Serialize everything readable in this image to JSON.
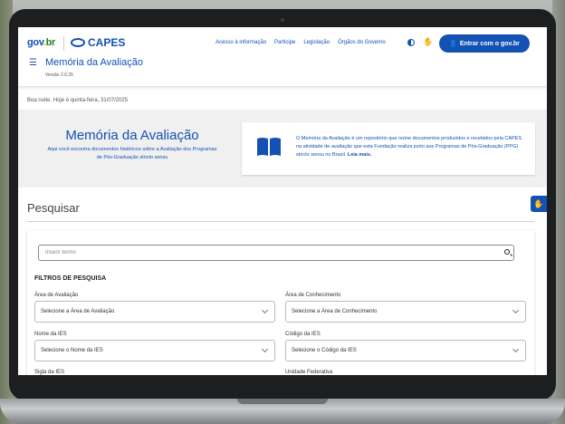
{
  "header": {
    "govbr_logo": {
      "part1": "gov",
      "part2": ".",
      "part3": "br"
    },
    "capes_logo": "CAPES",
    "nav": [
      "Acesso à informação",
      "Participe",
      "Legislação",
      "Órgãos do Governo"
    ],
    "login_button": "Entrar  com o gov.br",
    "site_title": "Memória da Avaliação",
    "version": "Versão 2.0.35"
  },
  "greeting": "Boa noite. Hoje é quinta-feira, 31/07/2025",
  "hero": {
    "title": "Memória da Avaliação",
    "subtitle": "Aqui você encontra documentos históricos sobre a Avaliação dos Programas de Pós-Graduação stricto sensu",
    "card_text": "O Memória da Avaliação é um repositório que reúne documentos produzidos e recebidos pela CAPES na atividade de avaliação que esta Fundação realiza junto aos Programas de Pós-Graduação (PPG) stricto sensu no Brasil.",
    "card_link": "Leia mais."
  },
  "search": {
    "heading": "Pesquisar",
    "placeholder": "Inserir termo",
    "filters_title": "FILTROS DE PESQUISA",
    "fields": [
      {
        "label": "Área de Avaliação",
        "value": "Selecione a Área de Avaliação"
      },
      {
        "label": "Área de Conhecimento",
        "value": "Selecione a Área de Conhecimento"
      },
      {
        "label": "Nome da IES",
        "value": "Selecione o Nome da IES"
      },
      {
        "label": "Código da IES",
        "value": "Selecione o Código da IES"
      },
      {
        "label": "Sigla da IES",
        "value": ""
      },
      {
        "label": "Unidade Federativa",
        "value": ""
      }
    ]
  },
  "colors": {
    "primary": "#1351b4",
    "hero_bg": "#f0f0f0"
  },
  "icons": [
    "menu-icon",
    "contrast-icon",
    "vlibras-icon",
    "user-icon",
    "book-icon",
    "search-icon",
    "chevron-down-icon",
    "feedback-icon"
  ]
}
